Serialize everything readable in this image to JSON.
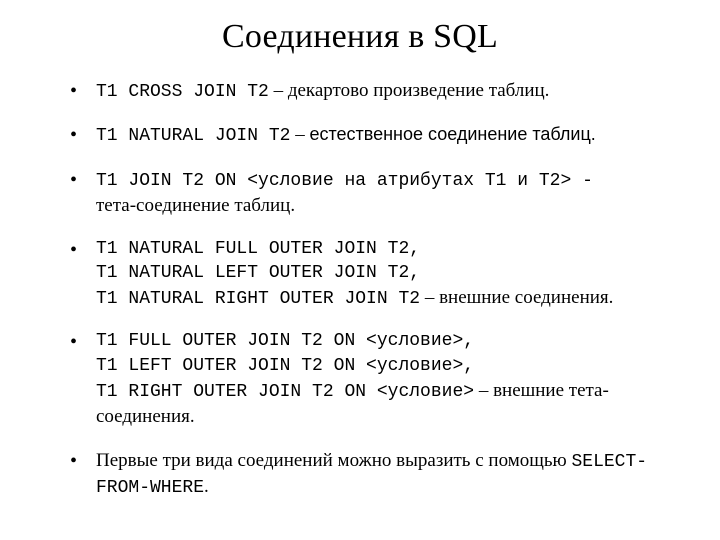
{
  "title": "Соединения в SQL",
  "items": [
    {
      "code1": "T1 CROSS JOIN T2",
      "dash": " – ",
      "desc": "декартово произведение таблиц."
    },
    {
      "code1": "T1 NATURAL JOIN T2",
      "dash": " – ",
      "desc_sans": "естественное соединение таблиц."
    },
    {
      "code1": "T1 JOIN T2 ON <условие на атрибутах T1 и T2>",
      "hyphen": " - ",
      "desc": "тета-соединение таблиц."
    },
    {
      "lines": [
        "T1 NATURAL FULL OUTER JOIN T2,",
        "T1 NATURAL LEFT OUTER JOIN T2,"
      ],
      "last_line_code": "T1 NATURAL RIGHT OUTER JOIN T2",
      "dash": " – ",
      "desc": "внешние соединения."
    },
    {
      "lines": [
        "T1 FULL  OUTER JOIN T2 ON <условие>,",
        "T1 LEFT  OUTER JOIN T2 ON <условие>,"
      ],
      "last_line_code": "T1 RIGHT OUTER JOIN T2 ON <условие>",
      "dash": " – ",
      "desc": "внешние тета-соединения."
    },
    {
      "note_pre": "Первые три вида соединений можно выразить с помощью ",
      "note_code": "SELECT-FROM-WHERE",
      "note_post": "."
    }
  ]
}
